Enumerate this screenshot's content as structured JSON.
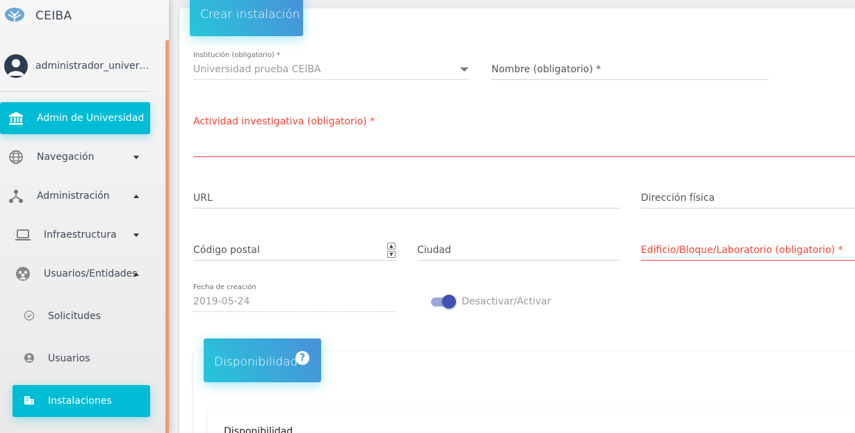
{
  "app": {
    "name": "CEIBA"
  },
  "user": {
    "name": "administrador_universidad"
  },
  "sidebar": {
    "items": [
      {
        "label": "Admin de Universidad",
        "icon": "bank-icon"
      },
      {
        "label": "Navegación",
        "icon": "globe-icon"
      },
      {
        "label": "Administración",
        "icon": "hierarchy-icon"
      },
      {
        "label": "Infraestructura",
        "icon": "laptop-icon"
      },
      {
        "label": "Usuarios/Entidades",
        "icon": "group-icon"
      },
      {
        "label": "Solicitudes",
        "icon": "check-circle-icon"
      },
      {
        "label": "Usuarios",
        "icon": "account-circle-icon"
      },
      {
        "label": "Instalaciones",
        "icon": "building-icon"
      }
    ],
    "accent_color": "#00bcd4"
  },
  "form": {
    "title": "Crear instalación",
    "institucion": {
      "label": "Institución (obligatorio) *",
      "value": "Universidad prueba CEIBA"
    },
    "nombre": {
      "placeholder": "Nombre (obligatorio) *"
    },
    "actividad": {
      "placeholder": "Actividad investigativa (obligatorio) *"
    },
    "url": {
      "placeholder": "URL"
    },
    "direccion": {
      "placeholder": "Dirección física"
    },
    "codigo_postal": {
      "placeholder": "Código postal"
    },
    "ciudad": {
      "placeholder": "Ciudad"
    },
    "edificio": {
      "placeholder": "Edificio/Bloque/Laboratorio (obligatorio) *"
    },
    "fecha": {
      "label": "Fecha de creación",
      "value": "2019-05-24"
    },
    "toggle": {
      "label": "Desactivar/Activar",
      "checked": true
    },
    "error_color": "#f44336"
  },
  "disponibilidad": {
    "title": "Disponibilidad",
    "help_icon": "?",
    "subtitle": "Disponibilidad"
  }
}
